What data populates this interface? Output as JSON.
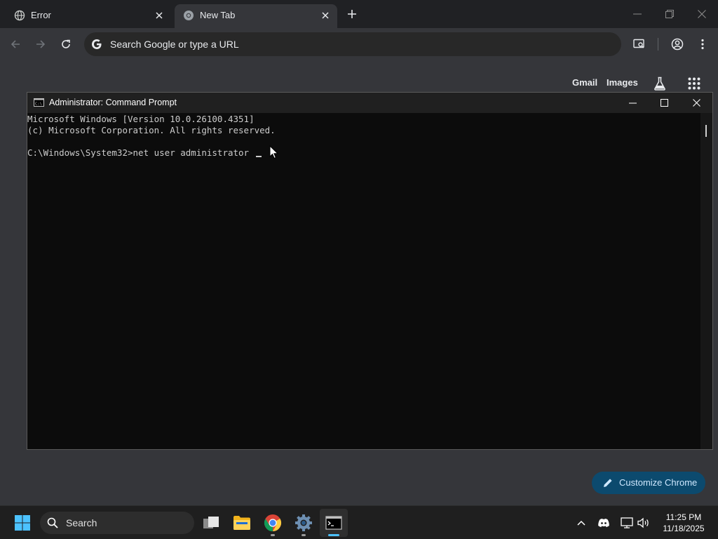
{
  "browser": {
    "tabs": [
      {
        "title": "Error",
        "icon": "globe-icon",
        "active": false
      },
      {
        "title": "New Tab",
        "icon": "chrome-icon",
        "active": true
      }
    ],
    "omnibox": {
      "placeholder": "Search Google or type a URL"
    },
    "ntp": {
      "gmail": "Gmail",
      "images": "Images"
    },
    "customize_label": "Customize Chrome"
  },
  "cmd": {
    "title": "Administrator: Command Prompt",
    "lines": [
      "Microsoft Windows [Version 10.0.26100.4351]",
      "(c) Microsoft Corporation. All rights reserved.",
      "",
      "C:\\Windows\\System32>net user administrator "
    ]
  },
  "taskbar": {
    "search_label": "Search",
    "time": "11:25 PM",
    "date": "11/18/2025",
    "apps": [
      "task-view",
      "file-explorer",
      "chrome",
      "settings",
      "terminal"
    ]
  },
  "colors": {
    "browser_bg": "#35363a",
    "tabstrip_bg": "#202124",
    "console_bg": "#0c0c0c",
    "accent": "#0c4a6e",
    "taskbar_bg": "#1f1f1f"
  }
}
